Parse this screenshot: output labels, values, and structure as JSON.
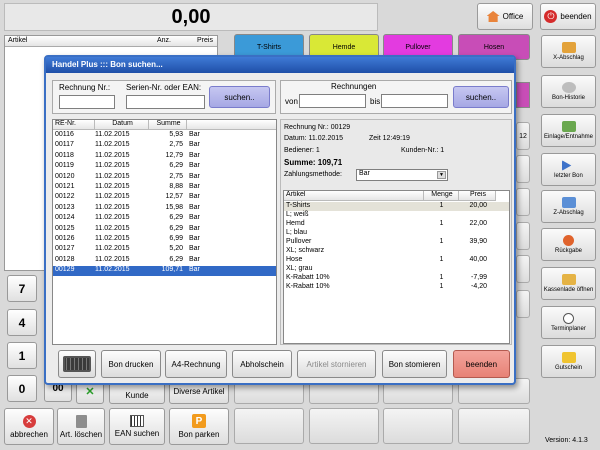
{
  "display": {
    "total": "0,00"
  },
  "top_buttons": {
    "office": "Office",
    "quit": "beenden"
  },
  "article_table": {
    "headers": [
      "Artikel",
      "Anz.",
      "Preis"
    ]
  },
  "categories": [
    "T-Shirts",
    "Hemde",
    "Pullover",
    "Hosen"
  ],
  "sidebar": {
    "items": [
      "X-Abschlag",
      "Bon-Historie",
      "Einlage/Entnahme",
      "letzter Bon",
      "Z-Abschlag",
      "Rückgabe",
      "Kassenlade öffnen",
      "Terminplaner",
      "Gutschein"
    ],
    "version": "Version: 4.1.3"
  },
  "keypad": [
    "7",
    "4",
    "1",
    "0",
    "00"
  ],
  "bottom": {
    "kunde": "Kunde",
    "diverse": "Diverse Artikel",
    "abbrechen": "abbrechen",
    "art_loeschen": "Art. löschen",
    "ean_suchen": "EAN suchen",
    "bon_parken": "Bon parken",
    "side_num": "12"
  },
  "dialog": {
    "title": "Handel Plus ::: Bon suchen...",
    "search": {
      "rechnung_label": "Rechnung Nr.:",
      "serien_label": "Serien-Nr. oder EAN:",
      "search_btn": "suchen..",
      "range_title": "Rechnungen",
      "von": "von",
      "bis": "bis",
      "range_btn": "suchen.."
    },
    "bons": {
      "headers": [
        "RE-Nr.",
        "Datum",
        "Summe",
        ""
      ],
      "rows": [
        [
          "00116",
          "11.02.2015",
          "5,93",
          "Bar"
        ],
        [
          "00117",
          "11.02.2015",
          "2,75",
          "Bar"
        ],
        [
          "00118",
          "11.02.2015",
          "12,79",
          "Bar"
        ],
        [
          "00119",
          "11.02.2015",
          "6,29",
          "Bar"
        ],
        [
          "00120",
          "11.02.2015",
          "2,75",
          "Bar"
        ],
        [
          "00121",
          "11.02.2015",
          "8,88",
          "Bar"
        ],
        [
          "00122",
          "11.02.2015",
          "12,57",
          "Bar"
        ],
        [
          "00123",
          "11.02.2015",
          "15,98",
          "Bar"
        ],
        [
          "00124",
          "11.02.2015",
          "6,29",
          "Bar"
        ],
        [
          "00125",
          "11.02.2015",
          "6,29",
          "Bar"
        ],
        [
          "00126",
          "11.02.2015",
          "6,99",
          "Bar"
        ],
        [
          "00127",
          "11.02.2015",
          "5,20",
          "Bar"
        ],
        [
          "00128",
          "11.02.2015",
          "6,29",
          "Bar"
        ],
        [
          "00129",
          "11.02.2015",
          "109,71",
          "Bar"
        ]
      ]
    },
    "detail": {
      "rechnung": "Rechnung Nr.:   00129",
      "datum": "Datum:  11.02.2015",
      "zeit": "Zeit 12:49:19",
      "bediener": "Bediener: 1",
      "kunden": "Kunden-Nr.: 1",
      "summe": "Summe:  109,71",
      "zahlung_label": "Zahlungsmethode:",
      "zahlung_value": "Bar"
    },
    "items": {
      "headers": [
        "Artikel",
        "Menge",
        "Preis"
      ],
      "rows": [
        [
          "T-Shirts",
          "1",
          "20,00"
        ],
        [
          "L; weiß",
          "",
          ""
        ],
        [
          "Hemd",
          "1",
          "22,00"
        ],
        [
          "L; blau",
          "",
          ""
        ],
        [
          "Pullover",
          "1",
          "39,90"
        ],
        [
          "XL; schwarz",
          "",
          ""
        ],
        [
          "Hose",
          "1",
          "40,00"
        ],
        [
          "XL; grau",
          "",
          ""
        ],
        [
          "K-Rabatt 10%",
          "1",
          "-7,99"
        ],
        [
          "K-Rabatt 10%",
          "1",
          "-4,20"
        ]
      ]
    },
    "buttons": {
      "bon_drucken": "Bon drucken",
      "a4": "A4-Rechnung",
      "abholschein": "Abholschein",
      "artikel_storno": "Artikel stornieren",
      "bon_storno": "Bon stomieren",
      "beenden": "beenden"
    }
  },
  "colors": {
    "tshirts": "#3b9ad8",
    "hemde": "#d9e836",
    "pullover": "#e33be0",
    "hosen": "#c84db7",
    "selection": "#3169c6",
    "quit": "#d52b2b"
  }
}
